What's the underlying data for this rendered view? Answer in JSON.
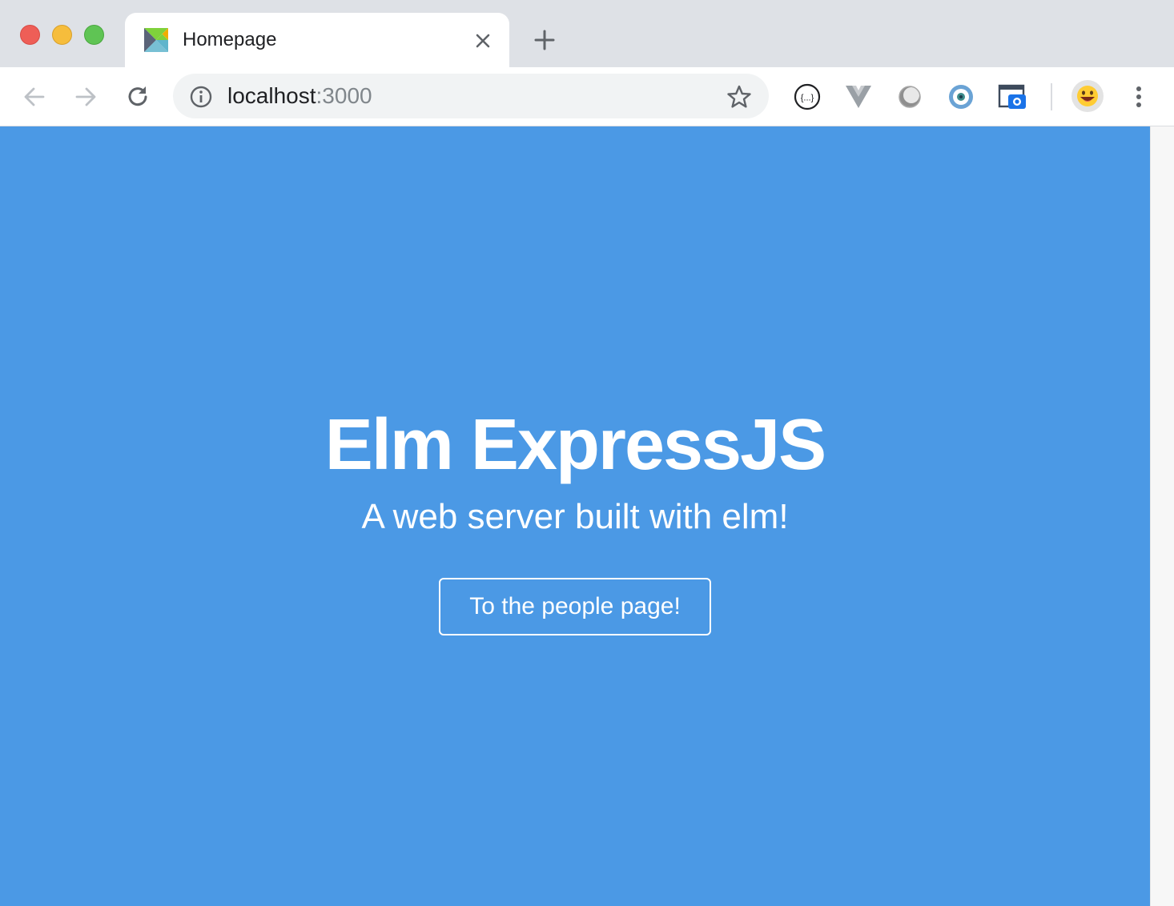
{
  "browser": {
    "tab": {
      "title": "Homepage",
      "favicon": "elm-tangram-icon"
    },
    "address_bar": {
      "host": "localhost",
      "port": ":3000"
    },
    "toolbar_icons": [
      "back-arrow-icon",
      "forward-arrow-icon",
      "reload-icon",
      "info-icon",
      "star-icon"
    ],
    "extensions": [
      "json-formatter-icon",
      "vue-devtools-icon",
      "ball-extension-icon",
      "eye-extension-icon",
      "screenshot-extension-icon"
    ],
    "profile": "emoji-avatar-icon",
    "menu": "kebab-menu-icon"
  },
  "page": {
    "title": "Elm ExpressJS",
    "subtitle": "A web server built with elm!",
    "cta_label": "To the people page!"
  },
  "colors": {
    "page_background": "#4b99e5",
    "text": "#ffffff",
    "tabstrip": "#dee1e6"
  }
}
